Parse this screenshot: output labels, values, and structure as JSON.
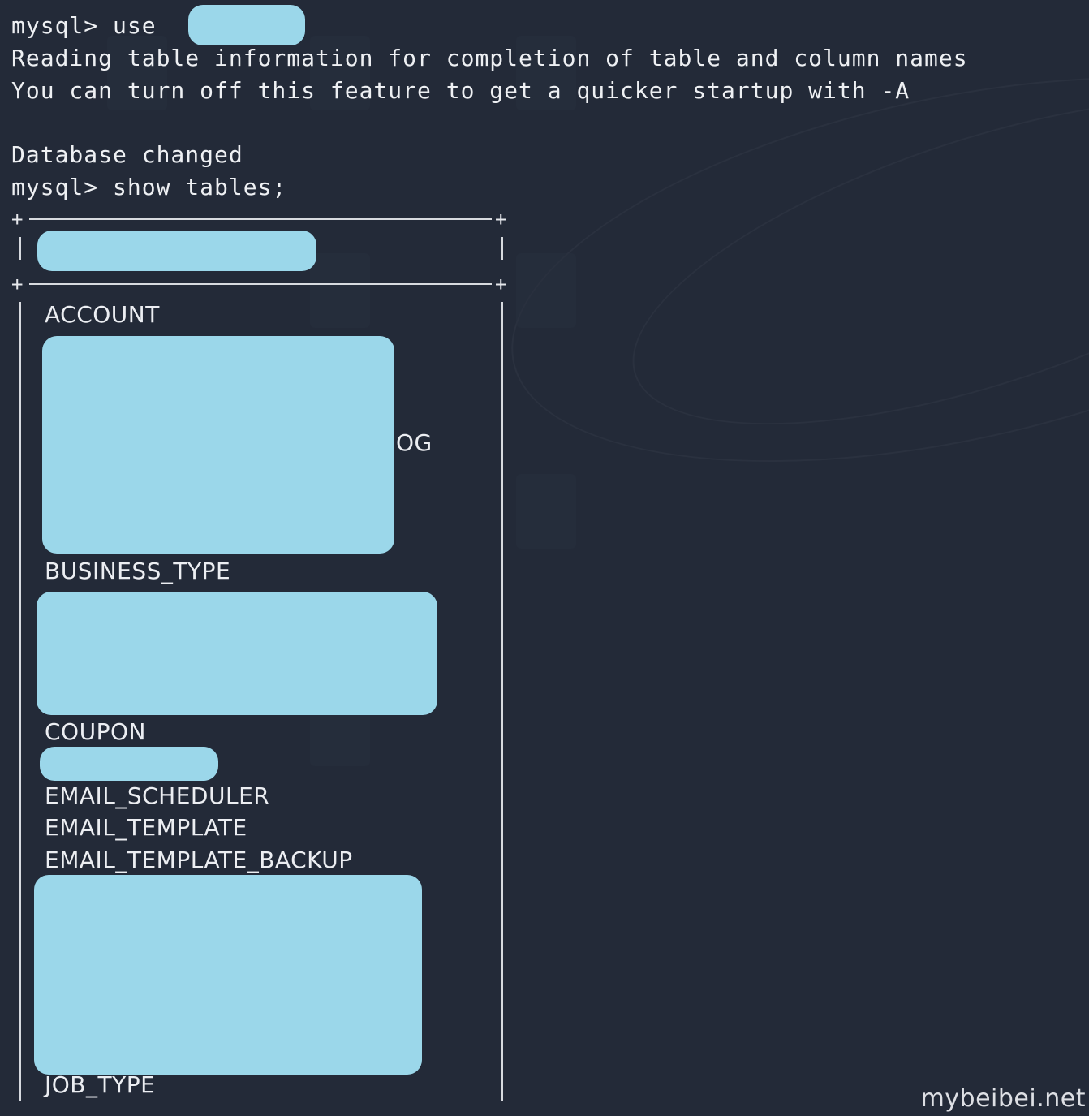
{
  "terminal": {
    "lines": [
      "mysql> use ",
      "Reading table information for completion of table and column names",
      "You can turn off this feature to get a quicker startup with -A",
      "",
      "Database changed",
      "mysql> show tables;"
    ],
    "table_rows": [
      "ACCOUNT",
      "OG",
      "BUSINESS_TYPE",
      "COUPON",
      "EMAIL_SCHEDULER",
      "EMAIL_TEMPLATE",
      "EMAIL_TEMPLATE_BACKUP",
      "JOB_TYPE"
    ]
  },
  "watermark": "mybeibei.net"
}
